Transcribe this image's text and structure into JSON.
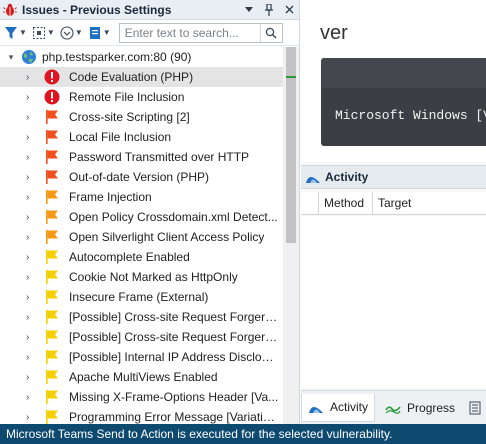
{
  "panel": {
    "title": "Issues - Previous Settings",
    "pin_glyph": "⊕",
    "close_glyph": "✕"
  },
  "toolbar": {
    "search_placeholder": "Enter text to search..."
  },
  "tree": {
    "root_label": "php.testsparker.com:80 (90)",
    "items": [
      {
        "label": "Code Evaluation (PHP)",
        "severity": "critical"
      },
      {
        "label": "Remote File Inclusion",
        "severity": "critical"
      },
      {
        "label": "Cross-site Scripting [2]",
        "severity": "high"
      },
      {
        "label": "Local File Inclusion",
        "severity": "high"
      },
      {
        "label": "Password Transmitted over HTTP",
        "severity": "high"
      },
      {
        "label": "Out-of-date Version (PHP)",
        "severity": "high"
      },
      {
        "label": "Frame Injection",
        "severity": "medium"
      },
      {
        "label": "Open Policy Crossdomain.xml Detect...",
        "severity": "medium"
      },
      {
        "label": "Open Silverlight Client Access Policy",
        "severity": "medium"
      },
      {
        "label": "Autocomplete Enabled",
        "severity": "low"
      },
      {
        "label": "Cookie Not Marked as HttpOnly",
        "severity": "low"
      },
      {
        "label": "Insecure Frame (External)",
        "severity": "low"
      },
      {
        "label": "[Possible] Cross-site Request Forgery ...",
        "severity": "low"
      },
      {
        "label": "[Possible] Cross-site Request Forgery ...",
        "severity": "low"
      },
      {
        "label": "[Possible] Internal IP Address Disclosu...",
        "severity": "low"
      },
      {
        "label": "Apache MultiViews Enabled",
        "severity": "low"
      },
      {
        "label": "Missing X-Frame-Options Header [Va...",
        "severity": "low"
      },
      {
        "label": "Programming Error Message [Variatio...",
        "severity": "low"
      }
    ]
  },
  "right": {
    "heading_partial": "ver",
    "console_text": "Microsoft Windows [V"
  },
  "activity": {
    "title": "Activity",
    "columns": [
      "Method",
      "Target"
    ]
  },
  "bottom_tabs": {
    "activity": "Activity",
    "progress": "Progress"
  },
  "status": {
    "message": "Microsoft Teams Send to Action is executed for the selected vulnerability."
  },
  "colors": {
    "critical": "#e0141e",
    "high": "#f0501e",
    "medium": "#f59a17",
    "low": "#f5d000",
    "status_bar": "#0e4a70",
    "selected_row": "#e4e4e4"
  }
}
